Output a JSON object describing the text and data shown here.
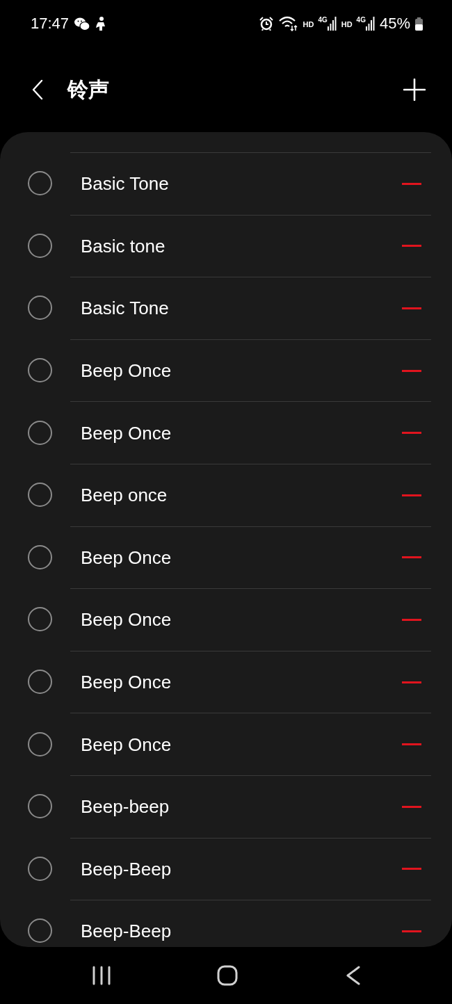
{
  "status_bar": {
    "time": "17:47",
    "sims": [
      {
        "hd": "HD",
        "network": "4G"
      },
      {
        "hd": "HD",
        "network": "4G"
      }
    ],
    "battery_percent": "45%"
  },
  "header": {
    "title": "铃声"
  },
  "ringtones": [
    {
      "name": "Basic Tone",
      "selected": false
    },
    {
      "name": "Basic tone",
      "selected": false
    },
    {
      "name": "Basic Tone",
      "selected": false
    },
    {
      "name": "Beep Once",
      "selected": false
    },
    {
      "name": "Beep Once",
      "selected": false
    },
    {
      "name": "Beep once",
      "selected": false
    },
    {
      "name": "Beep Once",
      "selected": false
    },
    {
      "name": "Beep Once",
      "selected": false
    },
    {
      "name": "Beep Once",
      "selected": false
    },
    {
      "name": "Beep Once",
      "selected": false
    },
    {
      "name": "Beep-beep",
      "selected": false
    },
    {
      "name": "Beep-Beep",
      "selected": false
    },
    {
      "name": "Beep-Beep",
      "selected": false
    }
  ]
}
